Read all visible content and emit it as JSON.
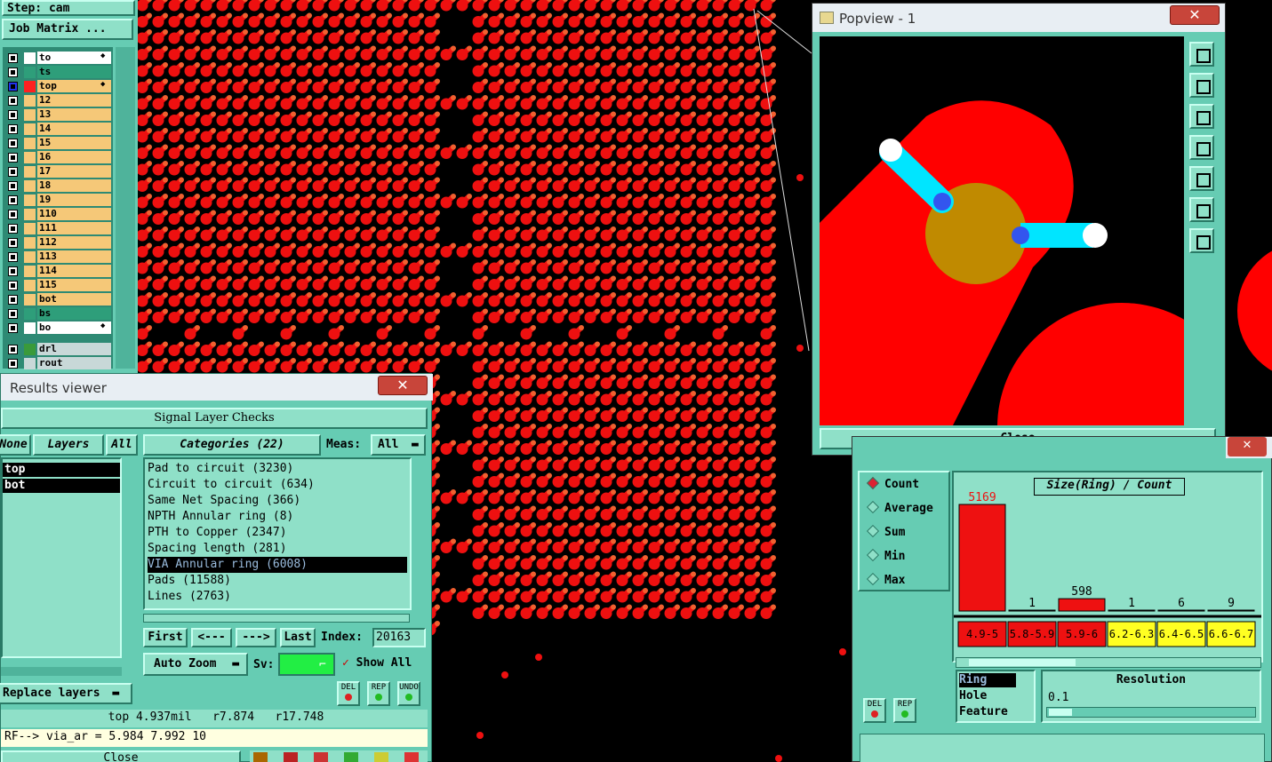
{
  "left_panel": {
    "step_label": "Step: cam",
    "job_matrix_label": "Job Matrix ...",
    "layers": [
      {
        "name": "to",
        "color": "#ffffff",
        "bg": "#ffffff",
        "has_arrow": true
      },
      {
        "name": "ts",
        "color": "#2e9e7a",
        "bg": "#2e9e7a",
        "has_arrow": false
      },
      {
        "name": "top",
        "color": "#ff2020",
        "bg": "#f5c878",
        "has_arrow": true,
        "active": true
      },
      {
        "name": "12",
        "color": "#f5c878",
        "bg": "#f5c878"
      },
      {
        "name": "13",
        "color": "#f5c878",
        "bg": "#f5c878"
      },
      {
        "name": "14",
        "color": "#f5c878",
        "bg": "#f5c878"
      },
      {
        "name": "15",
        "color": "#f5c878",
        "bg": "#f5c878"
      },
      {
        "name": "16",
        "color": "#f5c878",
        "bg": "#f5c878"
      },
      {
        "name": "17",
        "color": "#f5c878",
        "bg": "#f5c878"
      },
      {
        "name": "18",
        "color": "#f5c878",
        "bg": "#f5c878"
      },
      {
        "name": "19",
        "color": "#f5c878",
        "bg": "#f5c878"
      },
      {
        "name": "110",
        "color": "#f5c878",
        "bg": "#f5c878"
      },
      {
        "name": "111",
        "color": "#f5c878",
        "bg": "#f5c878"
      },
      {
        "name": "112",
        "color": "#f5c878",
        "bg": "#f5c878"
      },
      {
        "name": "113",
        "color": "#f5c878",
        "bg": "#f5c878"
      },
      {
        "name": "114",
        "color": "#f5c878",
        "bg": "#f5c878"
      },
      {
        "name": "115",
        "color": "#f5c878",
        "bg": "#f5c878"
      },
      {
        "name": "bot",
        "color": "#f5c878",
        "bg": "#f5c878"
      },
      {
        "name": "bs",
        "color": "#2e9e7a",
        "bg": "#2e9e7a"
      },
      {
        "name": "bo",
        "color": "#ffffff",
        "bg": "#ffffff",
        "has_arrow": true
      },
      {
        "name": "drl",
        "color": "#3a9a3a",
        "bg": "#c8d8d8"
      },
      {
        "name": "rout",
        "color": "#c8d8d8",
        "bg": "#c8d8d8"
      }
    ]
  },
  "results_viewer": {
    "title": "Results viewer",
    "close_label": "✕",
    "header": "Signal Layer Checks",
    "none_label": "None",
    "layers_label": "Layers",
    "all_label": "All",
    "categories_label": "Categories (22)",
    "meas_label": "Meas:",
    "meas_value": "All",
    "layer_items": [
      "top",
      "bot"
    ],
    "categories": [
      "Pad to circuit (3230)",
      "Circuit to circuit (634)",
      "Same Net Spacing (366)",
      "NPTH Annular ring (8)",
      "PTH to Copper (2347)",
      "Spacing length (281)",
      "VIA Annular ring (6008)",
      "Pads (11588)",
      "Lines (2763)"
    ],
    "selected_category_index": 6,
    "first_label": "First",
    "prev_label": "<---",
    "next_label": "--->",
    "last_label": "Last",
    "index_label": "Index:",
    "index_value": "20163",
    "auto_zoom_label": "Auto Zoom",
    "sv_label": "Sv:",
    "show_all_label": "Show All",
    "replace_layers_label": "Replace layers",
    "icon_labels": [
      "DEL",
      "REP",
      "UNDO"
    ],
    "status_1": "top 4.937mil   r7.874   r17.748",
    "status_2": "RF--> via_ar = 5.984 7.992 10",
    "close_button_label": "Close"
  },
  "popview": {
    "title": "Popview - 1",
    "close_x": "✕",
    "close_label": "Close"
  },
  "histogram": {
    "close_x": "✕",
    "radios": [
      "Count",
      "Average",
      "Sum",
      "Min",
      "Max"
    ],
    "selected_radio": "Count",
    "chart_title": "Size(Ring) / Count",
    "fields": [
      "Ring",
      "Hole",
      "Feature"
    ],
    "selected_field": "Ring",
    "resolution_label": "Resolution",
    "resolution_value": "0.1",
    "icon_labels": [
      "DEL",
      "REP"
    ],
    "chart_data": {
      "type": "bar",
      "categories": [
        "4.9-5",
        "5.8-5.9",
        "5.9-6",
        "6.2-6.3",
        "6.4-6.5",
        "6.6-6.7"
      ],
      "values": [
        5169,
        1,
        598,
        1,
        6,
        9
      ],
      "bar_colors": [
        "#ee1111",
        "#ee1111",
        "#ee1111",
        "#ffff22",
        "#ffff22",
        "#ffff22"
      ]
    }
  }
}
